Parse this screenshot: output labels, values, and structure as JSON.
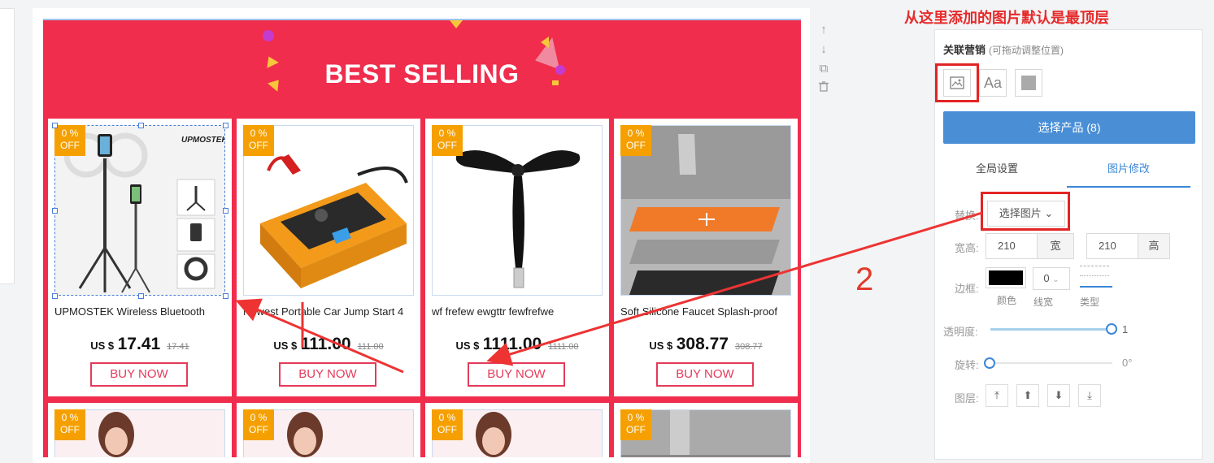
{
  "banner": {
    "title": "BEST SELLING"
  },
  "annotation": {
    "top_text": "从这里添加的图片默认是最顶层",
    "step_number": "2"
  },
  "side_tools": [
    {
      "name": "move-up-icon",
      "glyph": "↑"
    },
    {
      "name": "move-down-icon",
      "glyph": "↓"
    },
    {
      "name": "copy-icon",
      "glyph": "⧉"
    },
    {
      "name": "delete-icon",
      "glyph": "🗑"
    }
  ],
  "products": [
    {
      "badge_pct": "0 %",
      "badge_off": "OFF",
      "title": "UPMOSTEK Wireless Bluetooth",
      "currency": "US $",
      "price": "17.41",
      "old_price": "17.41",
      "button": "BUY NOW",
      "image_brand": "UPMOSTEK"
    },
    {
      "badge_pct": "0 %",
      "badge_off": "OFF",
      "title": "Newest Portable Car Jump Start 4",
      "currency": "US $",
      "price": "111.00",
      "old_price": "111.00",
      "button": "BUY NOW",
      "image_brand": ""
    },
    {
      "badge_pct": "0 %",
      "badge_off": "OFF",
      "title": "wf  frefew ewgttr  fewfrefwe",
      "currency": "US $",
      "price": "1111.00",
      "old_price": "1111.00",
      "button": "BUY NOW",
      "image_brand": ""
    },
    {
      "badge_pct": "0 %",
      "badge_off": "OFF",
      "title": "Soft Silicone Faucet Splash-proof",
      "currency": "US $",
      "price": "308.77",
      "old_price": "308.77",
      "button": "BUY NOW",
      "image_brand": ""
    },
    {
      "badge_pct": "0 %",
      "badge_off": "OFF"
    },
    {
      "badge_pct": "0 %",
      "badge_off": "OFF"
    },
    {
      "badge_pct": "0 %",
      "badge_off": "OFF"
    },
    {
      "badge_pct": "0 %",
      "badge_off": "OFF"
    }
  ],
  "panel": {
    "title": "关联营销",
    "subtitle": "(可拖动调整位置)",
    "tools": {
      "image": "image-icon",
      "text": "Aa",
      "shape": "square-icon"
    },
    "select_product": "选择产品 (8)",
    "tabs": [
      "全局设置",
      "图片修改"
    ],
    "replace_label": "替换:",
    "select_image": "选择图片 ⌄",
    "size_label": "宽高:",
    "width_value": "210",
    "width_unit": "宽",
    "height_value": "210",
    "height_unit": "高",
    "border_label": "边框:",
    "border_color_label": "颜色",
    "border_width_value": "0",
    "border_width_label": "线宽",
    "border_type_label": "类型",
    "opacity_label": "透明度:",
    "opacity_value": "1",
    "rotate_label": "旋转:",
    "rotate_value": "0°",
    "layer_label": "图层:",
    "colors": {
      "accent": "#4a8fd6",
      "banner": "#f02d4d",
      "badge": "#f5a000",
      "annotation": "#e62a2a"
    }
  }
}
